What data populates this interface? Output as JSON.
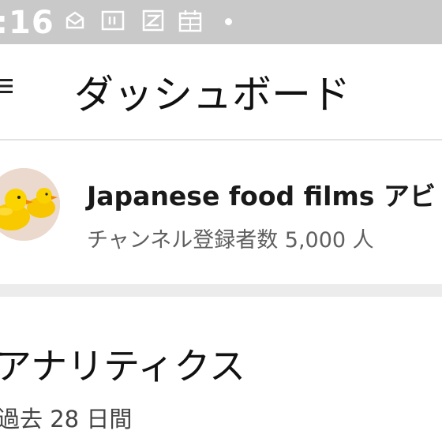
{
  "status_bar": {
    "time": ":16",
    "icons": [
      "mail-icon",
      "sim-card-icon",
      "app-notification-icon",
      "calendar-icon",
      "notification-dot-icon"
    ]
  },
  "app_bar": {
    "menu_icon": "hamburger-menu-icon",
    "title": "ダッシュボード"
  },
  "channel": {
    "avatar_icon": "rubber-duck-avatar",
    "name": "Japanese food films アビ",
    "subscribers": "チャンネル登録者数 5,000 人"
  },
  "analytics": {
    "title": "アナリティクス",
    "period": "過去 28 日間"
  },
  "colors": {
    "status_bar": "#c9c9c9",
    "section_gap": "#ececec",
    "title_text": "#111111",
    "secondary_text": "#5f5f5f"
  }
}
